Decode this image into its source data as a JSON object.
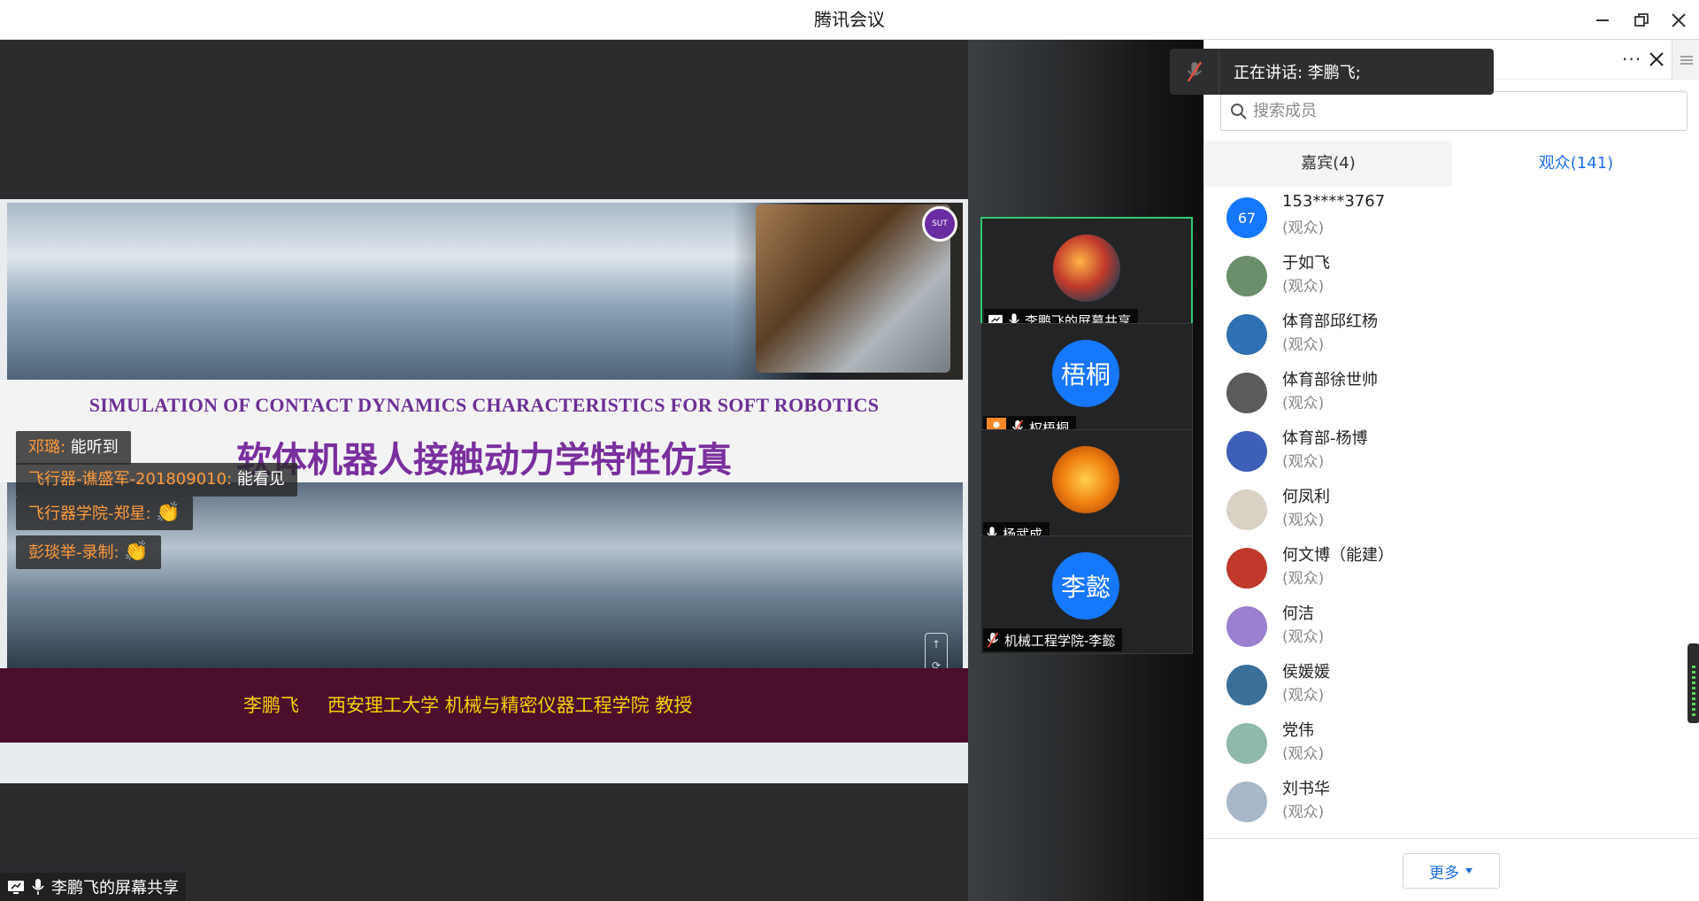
{
  "window": {
    "title": "腾讯会议"
  },
  "share": {
    "slide": {
      "en_title": "SIMULATION OF CONTACT DYNAMICS CHARACTERISTICS FOR SOFT ROBOTICS",
      "cn_title": "软体机器人接触动力学特性仿真",
      "logo_text": "SUT",
      "presenter_name": "李鹏飞",
      "presenter_affiliation": "西安理工大学 机械与精密仪器工程学院 教授"
    },
    "danmaku": [
      {
        "who": "邓璐: ",
        "msg": "能听到"
      },
      {
        "who": "飞行器-谯盛军-201809010: ",
        "msg": "能看见"
      },
      {
        "who": "飞行器学院-郑星: ",
        "msg": "👏"
      },
      {
        "who": "彭琰举-录制: ",
        "msg": "👏"
      }
    ],
    "presenter_tag": "李鹏飞的屏幕共享"
  },
  "videos": [
    {
      "label": "李鹏飞的屏幕共享",
      "avatar_text": "",
      "active": true
    },
    {
      "label": "权梧桐",
      "avatar_text": "梧桐",
      "active": false
    },
    {
      "label": "杨武成",
      "avatar_text": "",
      "active": false
    },
    {
      "label": "机械工程学院-李懿",
      "avatar_text": "李懿",
      "active": false
    }
  ],
  "speaking": {
    "text": "正在讲话: 李鹏飞;"
  },
  "panel": {
    "search_placeholder": "搜索成员",
    "tabs": [
      {
        "label": "嘉宾(4)",
        "active": false
      },
      {
        "label": "观众(141)",
        "active": true
      }
    ],
    "members": [
      {
        "name": "153****3767",
        "role": "(观众)",
        "avatar_text": "67",
        "color": "#1677ff"
      },
      {
        "name": "于如飞",
        "role": "(观众)",
        "avatar_text": "",
        "color": "#6b8e6b"
      },
      {
        "name": "体育部邱红杨",
        "role": "(观众)",
        "avatar_text": "",
        "color": "#2f6fb3"
      },
      {
        "name": "体育部徐世帅",
        "role": "(观众)",
        "avatar_text": "",
        "color": "#5b5b5b"
      },
      {
        "name": "体育部-杨博",
        "role": "(观众)",
        "avatar_text": "",
        "color": "#3d5fb8"
      },
      {
        "name": "何凤利",
        "role": "(观众)",
        "avatar_text": "",
        "color": "#d9d2c4"
      },
      {
        "name": "何文博（能建）",
        "role": "(观众)",
        "avatar_text": "",
        "color": "#c0392b"
      },
      {
        "name": "何洁",
        "role": "(观众)",
        "avatar_text": "",
        "color": "#9b7fd0"
      },
      {
        "name": "侯媛媛",
        "role": "(观众)",
        "avatar_text": "",
        "color": "#3a6f9a"
      },
      {
        "name": "党伟",
        "role": "(观众)",
        "avatar_text": "",
        "color": "#8fb9a8"
      },
      {
        "name": "刘书华",
        "role": "(观众)",
        "avatar_text": "",
        "color": "#a8b8c8"
      }
    ],
    "more_label": "更多"
  }
}
